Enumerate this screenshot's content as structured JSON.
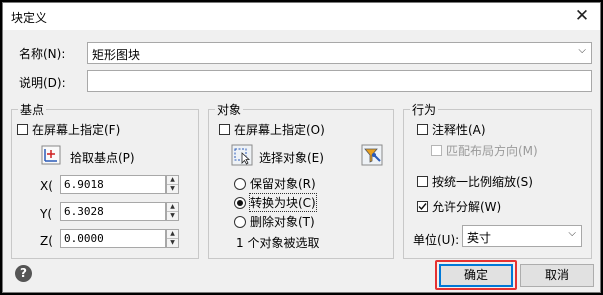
{
  "window": {
    "title": "块定义",
    "close_glyph": "✕"
  },
  "name_label": "名称(N):",
  "name_value": "矩形图块",
  "desc_label": "说明(D):",
  "desc_value": "",
  "base_point": {
    "legend": "基点",
    "specify_on_screen": "在屏幕上指定(F)",
    "pick_label": "拾取基点(P)",
    "x_label": "X(",
    "y_label": "Y(",
    "z_label": "Z(",
    "x_value": "6.9018",
    "y_value": "6.3028",
    "z_value": "0.0000"
  },
  "objects": {
    "legend": "对象",
    "specify_on_screen": "在屏幕上指定(O)",
    "select_label": "选择对象(E)",
    "retain": "保留对象(R)",
    "convert": "转换为块(C)",
    "delete": "删除对象(T)",
    "status": "1 个对象被选取",
    "selected_option": "convert"
  },
  "behavior": {
    "legend": "行为",
    "annotative": "注释性(A)",
    "match_layout": "匹配布局方向(M)",
    "scale_uniformly": "按统一比例缩放(S)",
    "allow_explode": "允许分解(W)",
    "allow_explode_checked": true,
    "unit_label": "单位(U):",
    "unit_value": "英寸"
  },
  "buttons": {
    "ok": "确定",
    "cancel": "取消"
  },
  "colors": {
    "highlight": "#e53232",
    "focus": "#0078d7"
  }
}
